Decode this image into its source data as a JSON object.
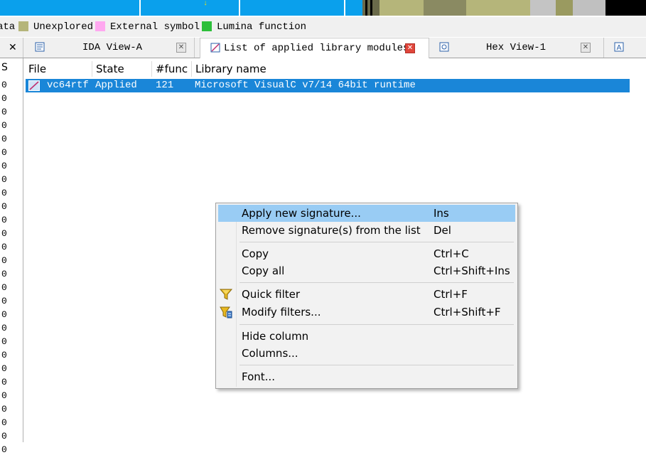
{
  "legend": {
    "items": [
      {
        "label": "ata",
        "color": ""
      },
      {
        "label": "Unexplored",
        "color": "#b5b57a"
      },
      {
        "label": "External symbol",
        "color": "#ffa8f0"
      },
      {
        "label": "Lumina function",
        "color": "#2dbf3a"
      }
    ]
  },
  "colors": {
    "nav_blue": "#0aa0ec",
    "nav_olive": "#b5b57a",
    "nav_gray": "#c0c0c0",
    "nav_black": "#000000",
    "selection": "#1a86d8",
    "menu_highlight": "#99ccf4"
  },
  "left_pane": {
    "header": "S",
    "values": [
      "0",
      "0",
      "0",
      "0",
      "0",
      "0",
      "0",
      "0",
      "0",
      "0",
      "0",
      "0",
      "0",
      "0",
      "0",
      "0",
      "0",
      "0",
      "0",
      "0",
      "0",
      "0",
      "0",
      "0",
      "0",
      "0",
      "0",
      "0"
    ]
  },
  "tabs": [
    {
      "label": "",
      "icon": "close-x-icon",
      "active": false
    },
    {
      "label": "IDA View-A",
      "icon": "ida-view-icon",
      "active": false
    },
    {
      "label": "List of applied library modules",
      "icon": "signature-list-icon",
      "active": true
    },
    {
      "label": "Hex View-1",
      "icon": "hex-view-icon",
      "active": false
    },
    {
      "label": "",
      "icon": "structures-icon",
      "active": false
    }
  ],
  "list": {
    "columns": [
      "File",
      "State",
      "#func",
      "Library name"
    ],
    "rows": [
      {
        "file": "vc64rtf",
        "state": "Applied",
        "funcs": "121",
        "library": "Microsoft VisualC v7/14 64bit runtime",
        "selected": true
      }
    ]
  },
  "context_menu": {
    "groups": [
      [
        {
          "label": "Apply new signature...",
          "shortcut": "Ins",
          "highlighted": true
        },
        {
          "label": "Remove signature(s) from the list",
          "shortcut": "Del"
        }
      ],
      [
        {
          "label": "Copy",
          "shortcut": "Ctrl+C"
        },
        {
          "label": "Copy all",
          "shortcut": "Ctrl+Shift+Ins"
        }
      ],
      [
        {
          "label": "Quick filter",
          "shortcut": "Ctrl+F",
          "icon": "funnel-icon"
        },
        {
          "label": "Modify filters...",
          "shortcut": "Ctrl+Shift+F",
          "icon": "funnel-edit-icon"
        }
      ],
      [
        {
          "label": "Hide column",
          "shortcut": ""
        },
        {
          "label": "Columns...",
          "shortcut": ""
        }
      ],
      [
        {
          "label": "Font...",
          "shortcut": ""
        }
      ]
    ]
  }
}
